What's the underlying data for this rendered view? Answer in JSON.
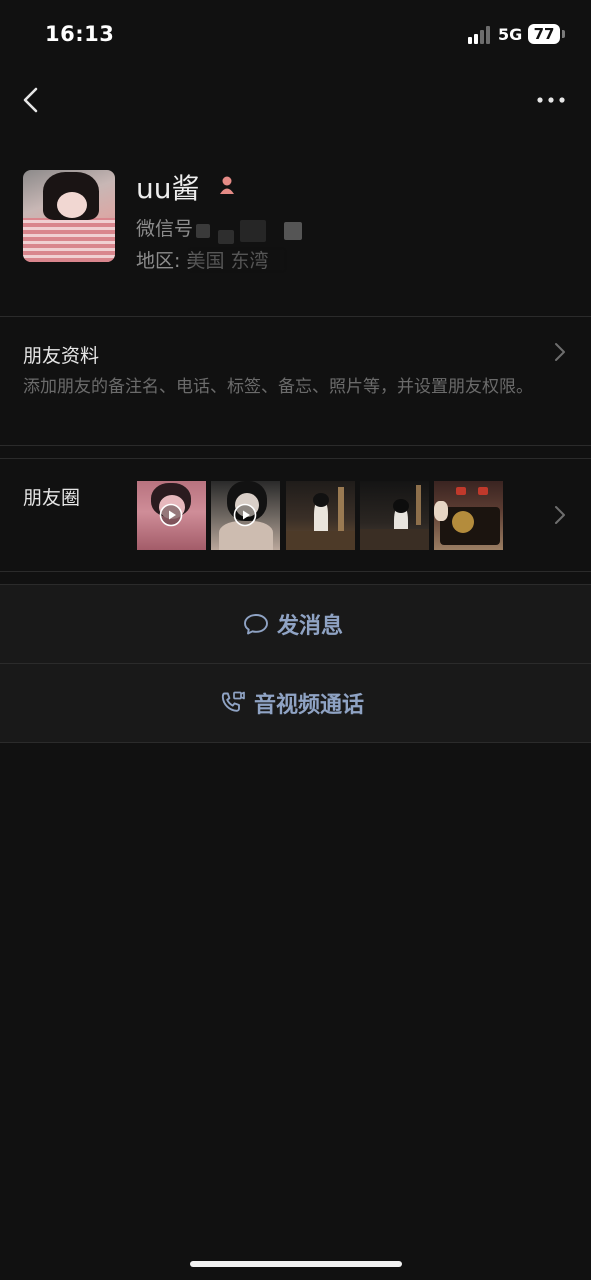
{
  "status_bar": {
    "time": "16:13",
    "network": "5G",
    "battery": "77"
  },
  "nav": {
    "back_icon": "chevron-left-icon",
    "more_icon": "more-horizontal-icon"
  },
  "profile": {
    "name": "uu酱",
    "gender_icon": "female-icon",
    "wechat_id_label": "微信号",
    "region_label": "地区",
    "region_value": ": 美国 东湾"
  },
  "friend_info": {
    "title": "朋友资料",
    "description": "添加朋友的备注名、电话、标签、备忘、照片等，并设置朋友权限。"
  },
  "moments": {
    "title": "朋友圈",
    "thumbnails": [
      {
        "type": "video"
      },
      {
        "type": "video"
      },
      {
        "type": "image"
      },
      {
        "type": "image"
      },
      {
        "type": "image"
      }
    ]
  },
  "actions": {
    "message_label": "发消息",
    "message_icon": "chat-bubble-icon",
    "call_label": "音视频通话",
    "call_icon": "video-call-icon"
  },
  "colors": {
    "background": "#111111",
    "card": "#191919",
    "action_text": "#8fa3c4",
    "secondary_text": "#8d8d8d"
  }
}
